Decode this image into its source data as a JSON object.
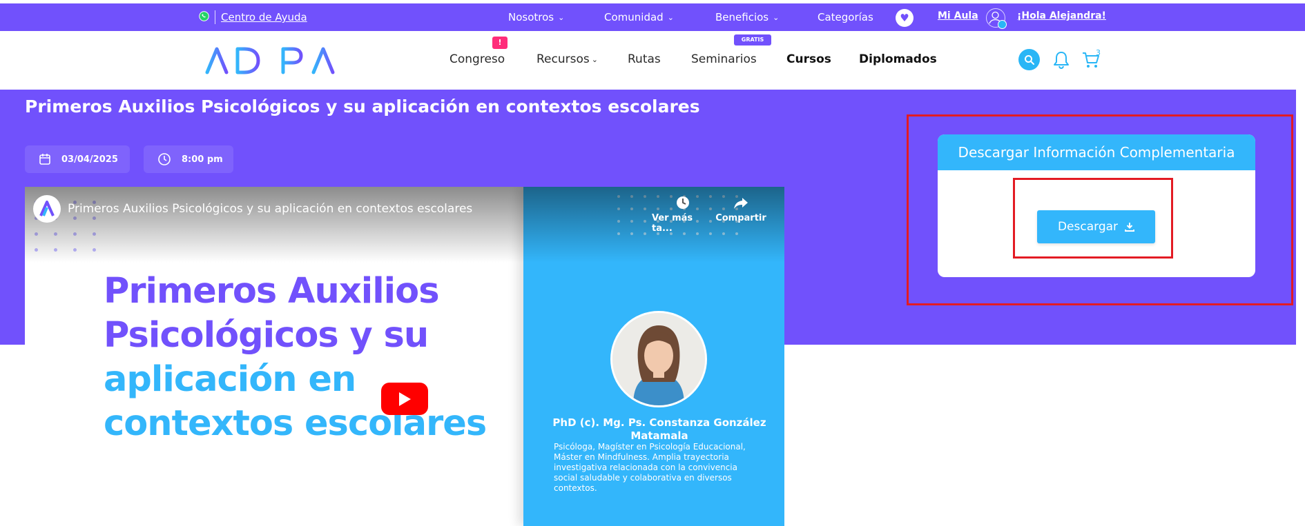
{
  "topbar": {
    "help_link": "Centro de Ayuda",
    "nav": [
      "Nosotros",
      "Comunidad",
      "Beneficios",
      "Categorías"
    ],
    "mi_aula": "Mi Aula",
    "greeting": "¡Hola Alejandra!"
  },
  "header": {
    "logo_text": "ADIPA",
    "nav": [
      "Congreso",
      "Recursos",
      "Rutas",
      "Seminarios",
      "Cursos",
      "Diplomados"
    ],
    "congreso_badge": "!",
    "seminarios_badge": "GRATIS",
    "cart_count": "3"
  },
  "event": {
    "title": "Primeros Auxilios Psicológicos y su aplicación en contextos escolares",
    "date": "03/04/2025",
    "time": "8:00 pm"
  },
  "video": {
    "title": "Primeros Auxilios Psicológicos y su aplicación en contextos escolares",
    "watch_later": "Ver más ta...",
    "share": "Compartir",
    "headline_lines": [
      "Primeros Auxilios",
      "Psicológicos y su",
      "aplicación en",
      "contextos escolares"
    ],
    "speaker_name": "PhD (c). Mg. Ps. Constanza González Matamala",
    "speaker_desc": "Psicóloga, Magíster en Psicología Educacional, Máster en Mindfulness. Amplia trayectoria investigativa relacionada con la convivencia social saludable y colaborativa en diversos contextos."
  },
  "download": {
    "heading": "Descargar Información Complementaria",
    "button": "Descargar"
  },
  "colors": {
    "brand_purple": "#7151fc",
    "brand_blue": "#33b6fb",
    "highlight_red": "#e31b23"
  }
}
